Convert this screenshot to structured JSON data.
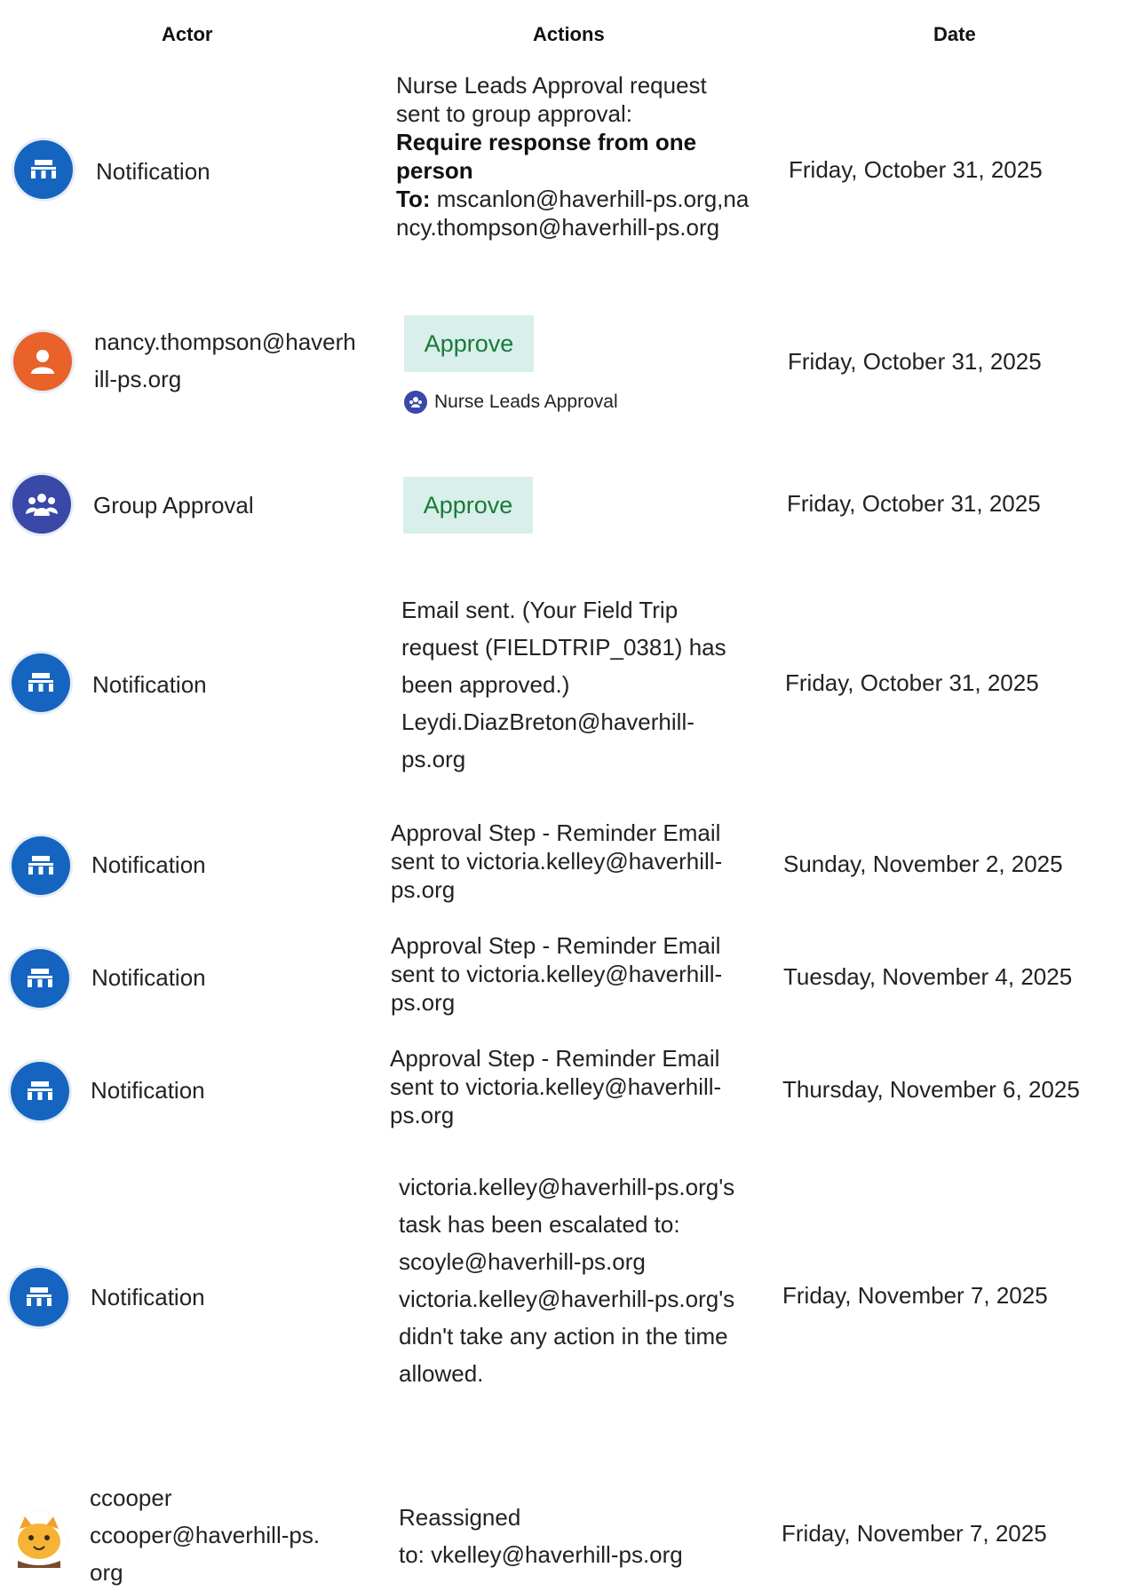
{
  "headers": {
    "actor": "Actor",
    "actions": "Actions",
    "date": "Date"
  },
  "rows": [
    {
      "actor": "Notification",
      "action_lines": [
        "Nurse Leads Approval request",
        "sent to group approval:"
      ],
      "action_bold": "Require response from one person",
      "action_to_label": "To:",
      "action_to_value": "mscanlon@haverhill-ps.org,nancy.thompson@haverhill-ps.org",
      "date": "Friday, October 31, 2025"
    },
    {
      "actor": "nancy.thompson@haverhill-ps.org",
      "button": "Approve",
      "sub_label": "Nurse Leads Approval",
      "date": "Friday, October 31, 2025"
    },
    {
      "actor": "Group Approval",
      "button": "Approve",
      "date": "Friday, October 31, 2025"
    },
    {
      "actor": "Notification",
      "action": "Email sent. (Your Field Trip request (FIELDTRIP_0381) has been approved.) Leydi.DiazBreton@haverhill-ps.org",
      "date": "Friday, October 31, 2025"
    },
    {
      "actor": "Notification",
      "action": "Approval Step - Reminder Email sent to victoria.kelley@haverhill-ps.org",
      "date": "Sunday, November 2, 2025"
    },
    {
      "actor": "Notification",
      "action": "Approval Step - Reminder Email sent to victoria.kelley@haverhill-ps.org",
      "date": "Tuesday, November 4, 2025"
    },
    {
      "actor": "Notification",
      "action": "Approval Step - Reminder Email sent to victoria.kelley@haverhill-ps.org",
      "date": "Thursday, November 6, 2025"
    },
    {
      "actor": "Notification",
      "action": "victoria.kelley@haverhill-ps.org's task has been escalated to: scoyle@haverhill-ps.org victoria.kelley@haverhill-ps.org's didn't take any action in the time allowed.",
      "date": "Friday, November 7, 2025"
    },
    {
      "actor_name": "ccooper",
      "actor_email": "ccooper@haverhill-ps.org",
      "action_line1": "Reassigned",
      "action_line2": "to: vkelley@haverhill-ps.org",
      "date": "Friday, November 7, 2025"
    }
  ],
  "icons": {
    "notification": "sitemap-icon",
    "user": "person-icon",
    "group": "group-icon",
    "mini": "group-mini-icon",
    "cat": "cat-avatar-icon"
  },
  "colors": {
    "notification_blue": "#1565c0",
    "user_orange": "#e8622a",
    "group_indigo": "#3a48a8",
    "approve_bg": "#d8efec",
    "approve_text": "#1a7a35"
  }
}
